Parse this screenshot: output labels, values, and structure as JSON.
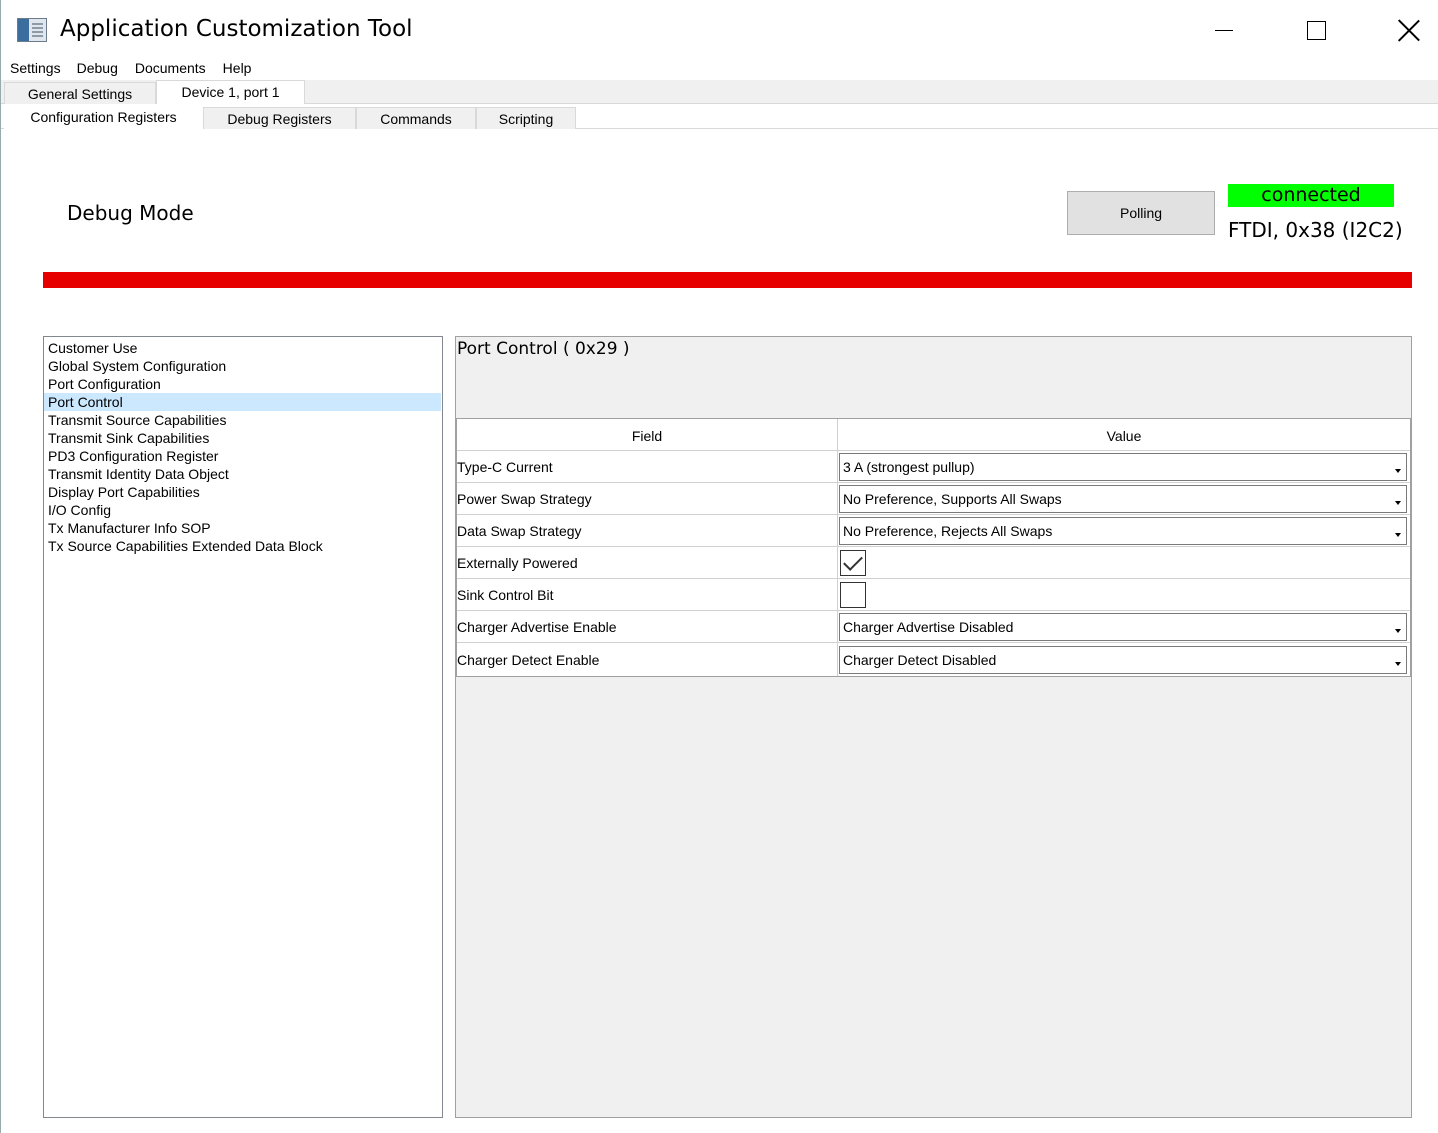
{
  "window": {
    "title": "Application Customization Tool"
  },
  "menu": [
    "Settings",
    "Debug",
    "Documents",
    "Help"
  ],
  "top_tabs": [
    "General Settings",
    "Device 1, port 1"
  ],
  "sub_tabs": [
    "Configuration Registers",
    "Debug Registers",
    "Commands",
    "Scripting"
  ],
  "header": {
    "mode_label": "Debug Mode",
    "polling_label": "Polling",
    "status": "connected",
    "device_info": "FTDI, 0x38 (I2C2)",
    "status_color": "#00ff00",
    "bar_color": "#e60000"
  },
  "registers": [
    "Customer Use",
    "Global System Configuration",
    "Port Configuration",
    "Port Control",
    "Transmit Source Capabilities",
    "Transmit Sink Capabilities",
    "PD3 Configuration Register",
    "Transmit Identity Data Object",
    "Display Port Capabilities",
    "I/O Config",
    "Tx Manufacturer Info SOP",
    "Tx Source Capabilities Extended Data Block"
  ],
  "selected_register": "Port Control",
  "detail": {
    "title": "Port Control  ( 0x29 )",
    "col_field": "Field",
    "col_value": "Value",
    "rows": [
      {
        "field": "Type-C Current",
        "value": "3 A (strongest pullup)"
      },
      {
        "field": "Power Swap Strategy",
        "value": "No Preference, Supports All Swaps"
      },
      {
        "field": "Data Swap Strategy",
        "value": "No Preference, Rejects All Swaps"
      },
      {
        "field": "Externally Powered",
        "checked": true
      },
      {
        "field": "Sink Control Bit",
        "checked": false
      },
      {
        "field": "Charger Advertise Enable",
        "value": "Charger Advertise Disabled"
      },
      {
        "field": "Charger Detect Enable",
        "value": "Charger Detect Disabled"
      }
    ]
  }
}
